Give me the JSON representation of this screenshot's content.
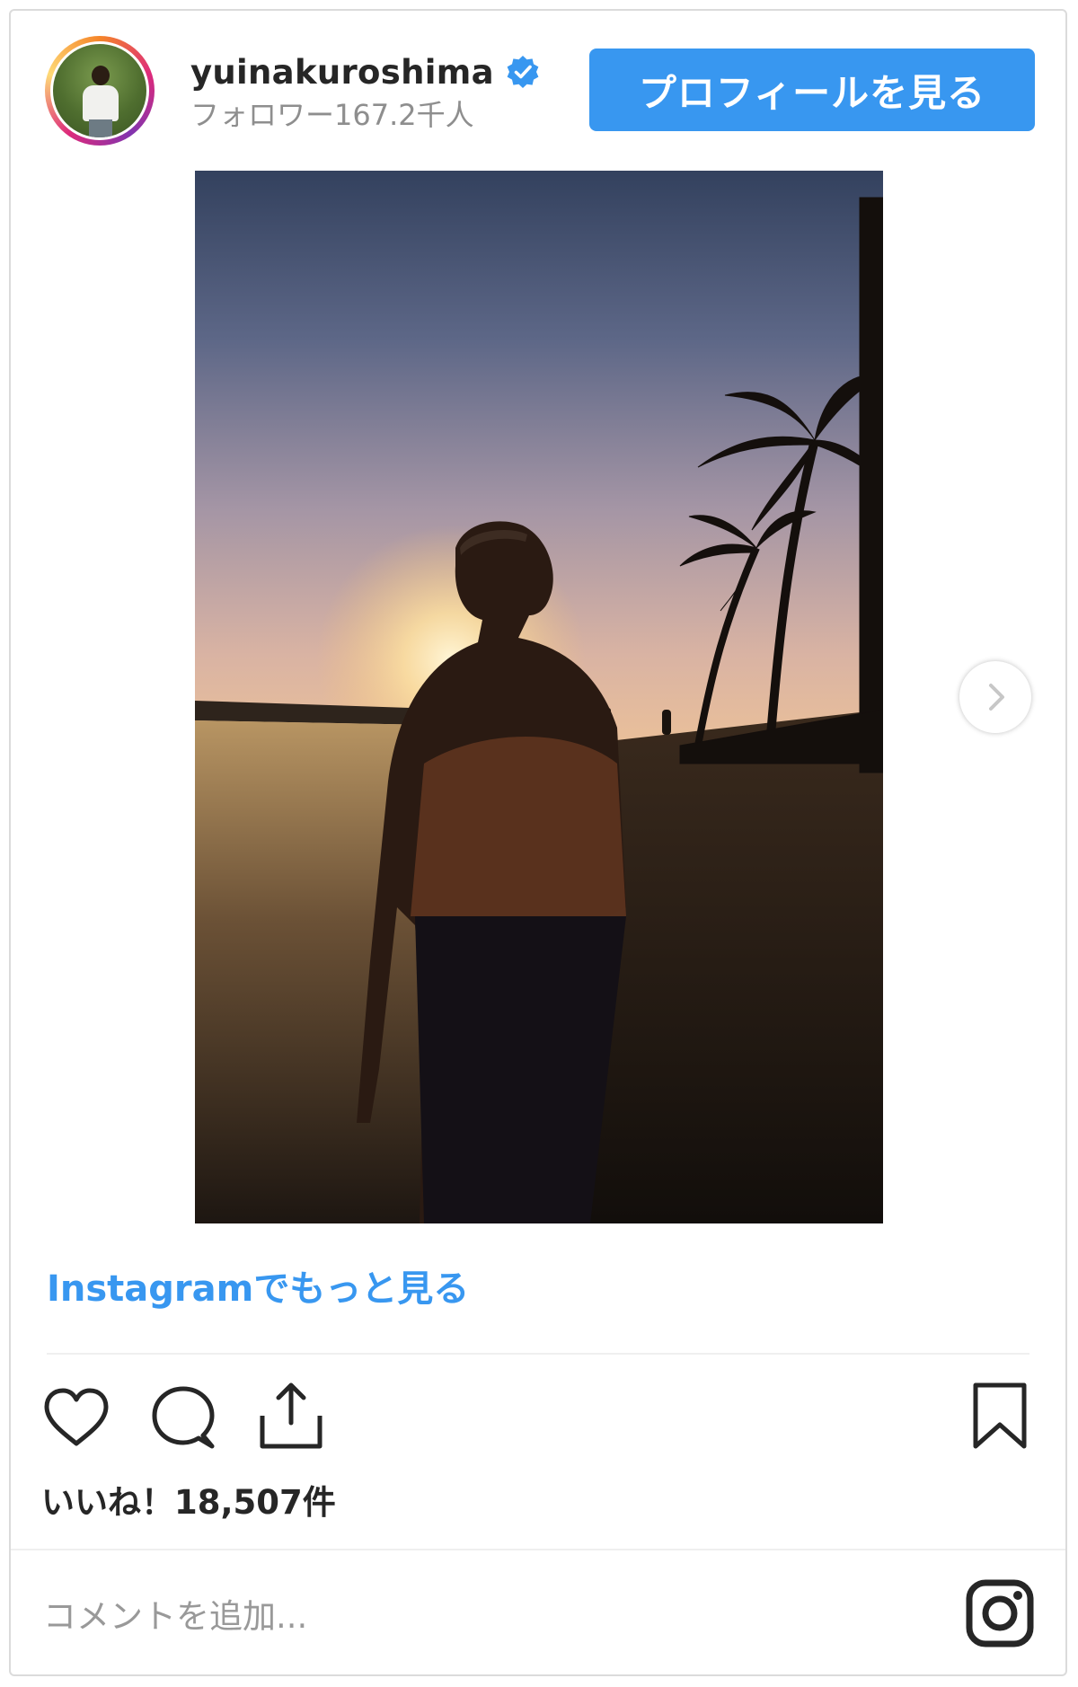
{
  "header": {
    "username": "yuinakuroshima",
    "followers": "フォロワー167.2千人",
    "profile_button": "プロフィールを見る"
  },
  "post": {
    "more_link": "Instagramでもっと見る",
    "likes": "いいね！18,507件",
    "comment_placeholder": "コメントを追加..."
  },
  "colors": {
    "accent": "#3897f0",
    "text": "#262626",
    "muted": "#8e8e8e"
  },
  "icons": [
    "verified-badge-icon",
    "heart-icon",
    "comment-icon",
    "share-icon",
    "bookmark-icon",
    "chevron-right-icon",
    "instagram-logo-icon"
  ]
}
